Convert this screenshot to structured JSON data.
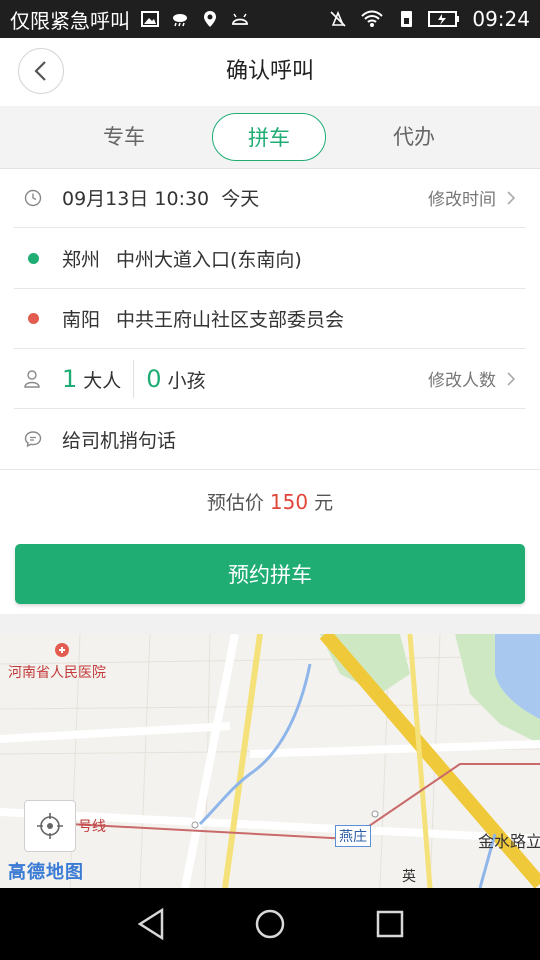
{
  "status_bar": {
    "carrier": "仅限紧急呼叫",
    "time": "09:24"
  },
  "header": {
    "title": "确认呼叫",
    "back_icon": "chevron-left-icon"
  },
  "tabs": [
    {
      "label": "专车",
      "active": false
    },
    {
      "label": "拼车",
      "active": true
    },
    {
      "label": "代办",
      "active": false
    }
  ],
  "time_row": {
    "value": "09月13日 10:30  今天",
    "action": "修改时间"
  },
  "origin": {
    "city": "郑州",
    "place": "中州大道入口(东南向)",
    "dot_color": "#1fad74"
  },
  "destination": {
    "city": "南阳",
    "place": "中共王府山社区支部委员会",
    "dot_color": "#e25d4f"
  },
  "passengers": {
    "adults": "1",
    "adults_label": "大人",
    "children": "0",
    "children_label": "小孩",
    "action": "修改人数"
  },
  "message": {
    "placeholder": "给司机捎句话"
  },
  "price": {
    "prefix": "预估价",
    "amount": "150",
    "unit": "元"
  },
  "book_button": {
    "label": "预约拼车"
  },
  "map": {
    "labels": {
      "hospital": "河南省人民医院",
      "line": "号线",
      "station": "燕庄",
      "road": "金水路立",
      "poi": "英"
    },
    "logo": "高德地图"
  },
  "colors": {
    "accent": "#1fad74",
    "price": "#e0463a"
  }
}
